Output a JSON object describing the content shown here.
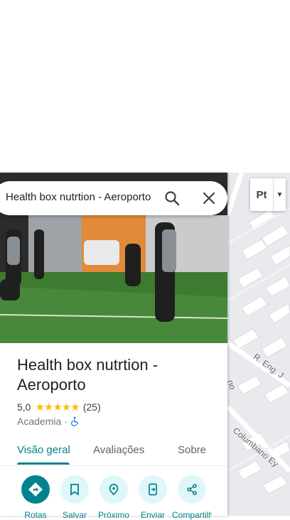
{
  "search": {
    "query": "Health box nutrtion - Aeroporto"
  },
  "place": {
    "title": "Health box nutrtion - Aeroporto",
    "rating": "5,0",
    "stars": "★★★★★",
    "review_count": "(25)",
    "category": "Academia",
    "separator": "·"
  },
  "tabs": [
    {
      "label": "Visão geral"
    },
    {
      "label": "Avaliações"
    },
    {
      "label": "Sobre"
    }
  ],
  "actions": [
    {
      "label": "Rotas",
      "icon": "directions-icon"
    },
    {
      "label": "Salvar",
      "icon": "bookmark-icon"
    },
    {
      "label": "Próximo",
      "icon": "nearby-icon"
    },
    {
      "label": "Enviar",
      "icon": "send-to-phone-icon"
    },
    {
      "label": "Compartilhar",
      "icon": "share-icon"
    }
  ],
  "map": {
    "layer_abbr": "Pt",
    "street_1": "R. Eng. J",
    "street_2": "Columbano Ey",
    "street_3": "no"
  },
  "colors": {
    "accent": "#00838f",
    "accent_light": "#e0f7fa",
    "star": "#fbbc04"
  }
}
